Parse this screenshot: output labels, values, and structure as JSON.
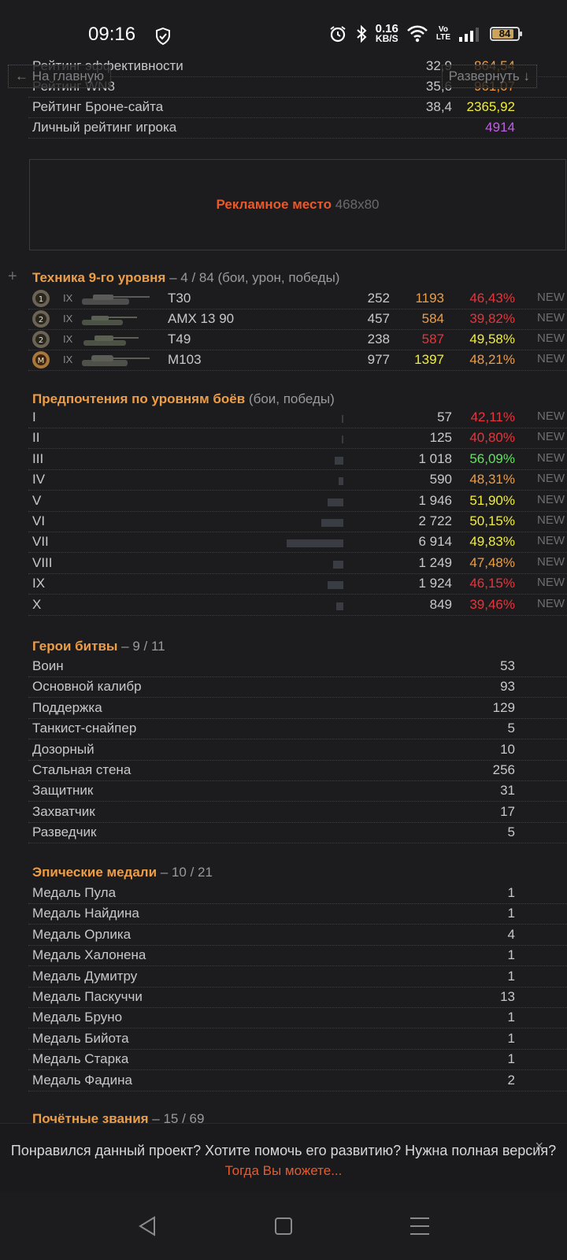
{
  "status_bar": {
    "time": "09:16",
    "net_speed_value": "0.16",
    "net_speed_unit": "KB/S",
    "volte_top": "Vo",
    "volte_bottom": "LTE",
    "battery": "84",
    "battery_level": 0.84
  },
  "nav": {
    "back_label": "← На главную",
    "expand_label": "Развернуть ↓"
  },
  "ratings": [
    {
      "label": "Рейтинг эффективности",
      "v1": "32,9",
      "v2": "864,54"
    },
    {
      "label": "Рейтинг WN8",
      "v1": "35,6",
      "v2": "961,07"
    },
    {
      "label": "Рейтинг Броне-сайта",
      "v1": "38,4",
      "v2": "2365,92"
    },
    {
      "label": "Личный рейтинг игрока",
      "v1": "",
      "v2": "4914"
    }
  ],
  "ad": {
    "title": "Рекламное место",
    "size": "468x80"
  },
  "tech": {
    "title": "Техника 9-го уровня",
    "subtitle": " – 4 / 84 (бои, урон, победы)",
    "rows": [
      {
        "medal": "1",
        "tier": "IX",
        "name": "T30",
        "battles": "252",
        "damage": "1193",
        "winrate": "46,43%",
        "new": "NEW"
      },
      {
        "medal": "2",
        "tier": "IX",
        "name": "AMX 13 90",
        "battles": "457",
        "damage": "584",
        "winrate": "39,82%",
        "new": "NEW"
      },
      {
        "medal": "2",
        "tier": "IX",
        "name": "T49",
        "battles": "238",
        "damage": "587",
        "winrate": "49,58%",
        "new": "NEW"
      },
      {
        "medal": "M",
        "tier": "IX",
        "name": "M103",
        "battles": "977",
        "damage": "1397",
        "winrate": "48,21%",
        "new": "NEW"
      }
    ]
  },
  "levels": {
    "title": "Предпочтения по уровням боёв",
    "subtitle": " (бои, победы)",
    "rows": [
      {
        "level": "I",
        "battles": "57",
        "battles_num": 57,
        "winrate": "42,11%",
        "new": "NEW"
      },
      {
        "level": "II",
        "battles": "125",
        "battles_num": 125,
        "winrate": "40,80%",
        "new": "NEW"
      },
      {
        "level": "III",
        "battles": "1 018",
        "battles_num": 1018,
        "winrate": "56,09%",
        "new": "NEW"
      },
      {
        "level": "IV",
        "battles": "590",
        "battles_num": 590,
        "winrate": "48,31%",
        "new": "NEW"
      },
      {
        "level": "V",
        "battles": "1 946",
        "battles_num": 1946,
        "winrate": "51,90%",
        "new": "NEW"
      },
      {
        "level": "VI",
        "battles": "2 722",
        "battles_num": 2722,
        "winrate": "50,15%",
        "new": "NEW"
      },
      {
        "level": "VII",
        "battles": "6 914",
        "battles_num": 6914,
        "winrate": "49,83%",
        "new": "NEW"
      },
      {
        "level": "VIII",
        "battles": "1 249",
        "battles_num": 1249,
        "winrate": "47,48%",
        "new": "NEW"
      },
      {
        "level": "IX",
        "battles": "1 924",
        "battles_num": 1924,
        "winrate": "46,15%",
        "new": "NEW"
      },
      {
        "level": "X",
        "battles": "849",
        "battles_num": 849,
        "winrate": "39,46%",
        "new": "NEW"
      }
    ]
  },
  "heroes": {
    "title": "Герои битвы",
    "subtitle": " – 9 / 11",
    "rows": [
      {
        "label": "Воин",
        "value": "53"
      },
      {
        "label": "Основной калибр",
        "value": "93"
      },
      {
        "label": "Поддержка",
        "value": "129"
      },
      {
        "label": "Танкист-снайпер",
        "value": "5"
      },
      {
        "label": "Дозорный",
        "value": "10"
      },
      {
        "label": "Стальная стена",
        "value": "256"
      },
      {
        "label": "Защитник",
        "value": "31"
      },
      {
        "label": "Захватчик",
        "value": "17"
      },
      {
        "label": "Разведчик",
        "value": "5"
      }
    ]
  },
  "epic": {
    "title": "Эпические медали",
    "subtitle": " – 10 / 21",
    "rows": [
      {
        "label": "Медаль Пула",
        "value": "1"
      },
      {
        "label": "Медаль Найдина",
        "value": "1"
      },
      {
        "label": "Медаль Орлика",
        "value": "4"
      },
      {
        "label": "Медаль Халонена",
        "value": "1"
      },
      {
        "label": "Медаль Думитру",
        "value": "1"
      },
      {
        "label": "Медаль Паскуччи",
        "value": "13"
      },
      {
        "label": "Медаль Бруно",
        "value": "1"
      },
      {
        "label": "Медаль Бийота",
        "value": "1"
      },
      {
        "label": "Медаль Старка",
        "value": "1"
      },
      {
        "label": "Медаль Фадина",
        "value": "2"
      }
    ]
  },
  "honor": {
    "title": "Почётные звания",
    "subtitle": " – 15 / 69"
  },
  "banner": {
    "question": "Понравился данный проект? Хотите помочь его развитию? Нужна полная версия?",
    "link": "Тогда Вы можете...",
    "close": "×"
  },
  "colors": {
    "orange": "#ee9d47",
    "red": "#e8343b",
    "yellow": "#f0ee3c",
    "green": "#5ce65a",
    "violet": "#c25ee8"
  }
}
